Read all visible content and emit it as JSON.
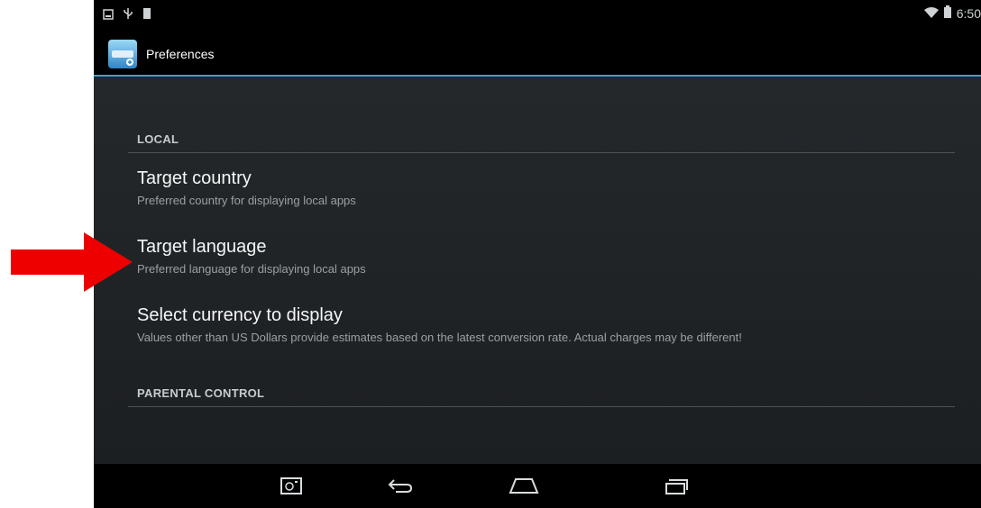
{
  "status_bar": {
    "time": "6:50"
  },
  "action_bar": {
    "title": "Preferences"
  },
  "sections": {
    "local": {
      "header": "LOCAL"
    },
    "parental": {
      "header": "PARENTAL CONTROL"
    }
  },
  "preferences": [
    {
      "title": "Target country",
      "summary": "Preferred country for displaying local apps"
    },
    {
      "title": "Target language",
      "summary": "Preferred language for displaying local apps"
    },
    {
      "title": "Select currency to display",
      "summary": "Values other than US Dollars provide estimates based on the latest conversion rate. Actual charges may be different!"
    }
  ],
  "colors": {
    "accent": "#33a5cf",
    "annotation_arrow": "#ee0000"
  }
}
